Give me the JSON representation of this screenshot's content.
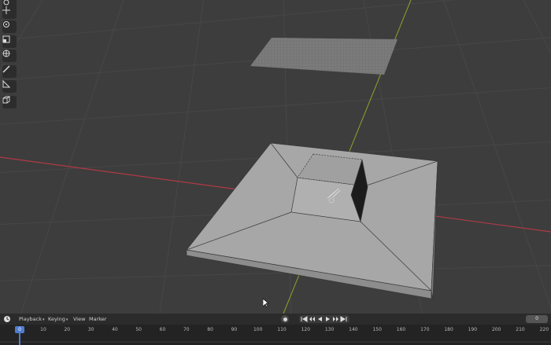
{
  "tools": [
    {
      "name": "cursor-tool-icon"
    },
    {
      "name": "move-tool-icon"
    },
    {
      "name": "rotate-tool-icon"
    },
    {
      "name": "scale-tool-icon"
    },
    {
      "name": "transform-tool-icon"
    },
    {
      "name": "annotate-tool-icon"
    },
    {
      "name": "measure-tool-icon"
    },
    {
      "name": "add-cube-tool-icon"
    }
  ],
  "timeline": {
    "menus": [
      "Playback",
      "Keying",
      "View",
      "Marker"
    ],
    "current_frame": "0",
    "playhead_label": "0",
    "ticks": [
      "10",
      "20",
      "30",
      "40",
      "50",
      "60",
      "70",
      "80",
      "90",
      "100",
      "110",
      "120",
      "130",
      "140",
      "150",
      "160",
      "170",
      "180",
      "190",
      "200",
      "210",
      "220"
    ]
  },
  "colors": {
    "viewport_bg": "#3d3d3d",
    "x_axis": "#b03a46",
    "y_axis": "#8aa62a",
    "accent": "#4f7ccf"
  }
}
